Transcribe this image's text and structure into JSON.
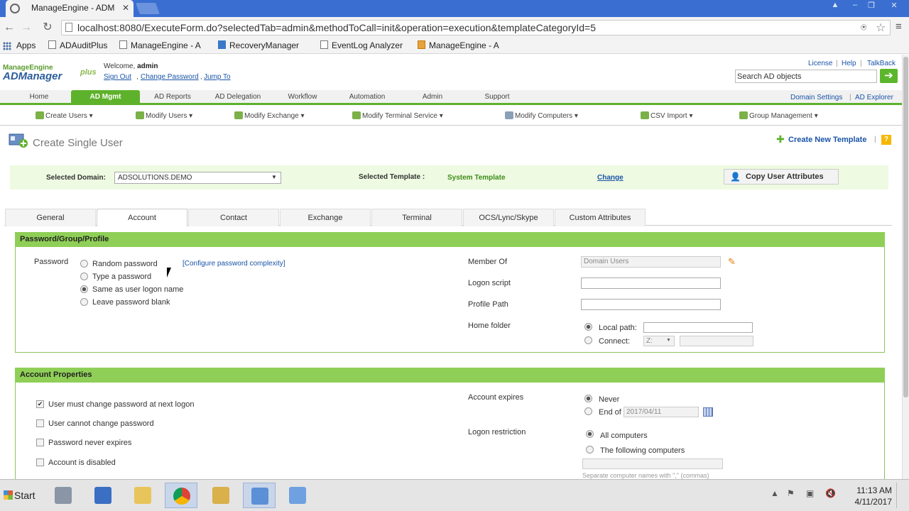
{
  "browser": {
    "tab_title": "ManageEngine - ADM",
    "url": "localhost:8080/ExecuteForm.do?selectedTab=admin&methodToCall=init&operation=execution&templateCategoryId=5",
    "bookmarks": [
      "Apps",
      "ADAuditPlus",
      "ManageEngine - A",
      "RecoveryManager",
      "EventLog Analyzer",
      "ManageEngine - A"
    ]
  },
  "header": {
    "logo_top": "ManageEngine",
    "logo_main": "ADManager",
    "logo_plus": "plus",
    "welcome_label": "Welcome,",
    "user": "admin",
    "links": [
      "Sign Out",
      "Change Password",
      "Jump To"
    ],
    "right_links": [
      "License",
      "Help",
      "TalkBack"
    ],
    "search_placeholder": "Search AD objects",
    "domain_links": [
      "Domain Settings",
      "AD Explorer"
    ]
  },
  "main_nav": [
    "Home",
    "AD Mgmt",
    "AD Reports",
    "AD Delegation",
    "Workflow",
    "Automation",
    "Admin",
    "Support"
  ],
  "active_main_nav": "AD Mgmt",
  "sub_nav": [
    "Create Users",
    "Modify Users",
    "Modify Exchange",
    "Modify Terminal Service",
    "Modify Computers",
    "CSV Import",
    "Group Management"
  ],
  "page": {
    "title": "Create Single User",
    "create_template": "Create New Template",
    "help": "?"
  },
  "domain_bar": {
    "domain_label": "Selected Domain:",
    "domain_value": "ADSOLUTIONS.DEMO",
    "template_label": "Selected Template :",
    "template_value": "System Template",
    "change": "Change",
    "copy_button": "Copy User Attributes"
  },
  "tabs": [
    "General",
    "Account",
    "Contact",
    "Exchange",
    "Terminal",
    "OCS/Lync/Skype",
    "Custom Attributes"
  ],
  "active_tab": "Account",
  "password_section": {
    "heading": "Password/Group/Profile",
    "password_label": "Password",
    "options": [
      "Random password",
      "Type a password",
      "Same as user logon name",
      "Leave password blank"
    ],
    "selected_option": "Same as user logon name",
    "config_link": "[Configure password complexity]",
    "member_of_label": "Member Of",
    "member_of_value": "Domain Users",
    "logon_script_label": "Logon script",
    "profile_path_label": "Profile Path",
    "home_folder_label": "Home folder",
    "local_path_label": "Local path:",
    "connect_label": "Connect:",
    "connect_drive": "Z:"
  },
  "account_section": {
    "heading": "Account Properties",
    "checkboxes": [
      {
        "label": "User must change password at next logon",
        "checked": true
      },
      {
        "label": "User cannot change password",
        "checked": false
      },
      {
        "label": "Password never expires",
        "checked": false
      },
      {
        "label": "Account is disabled",
        "checked": false
      }
    ],
    "expires_label": "Account expires",
    "never_label": "Never",
    "end_of_label": "End of",
    "end_of_date": "2017/04/11",
    "logon_restriction_label": "Logon restriction",
    "all_computers": "All computers",
    "following_computers": "The following computers",
    "separator_hint": "Separate computer names with \",\" (commas)"
  },
  "taskbar": {
    "start": "Start",
    "time": "11:13 AM",
    "date": "4/11/2017"
  },
  "colors": {
    "brand_green": "#5eb22b",
    "link_blue": "#1a54a7",
    "titlebar": "#3a6fd1"
  }
}
